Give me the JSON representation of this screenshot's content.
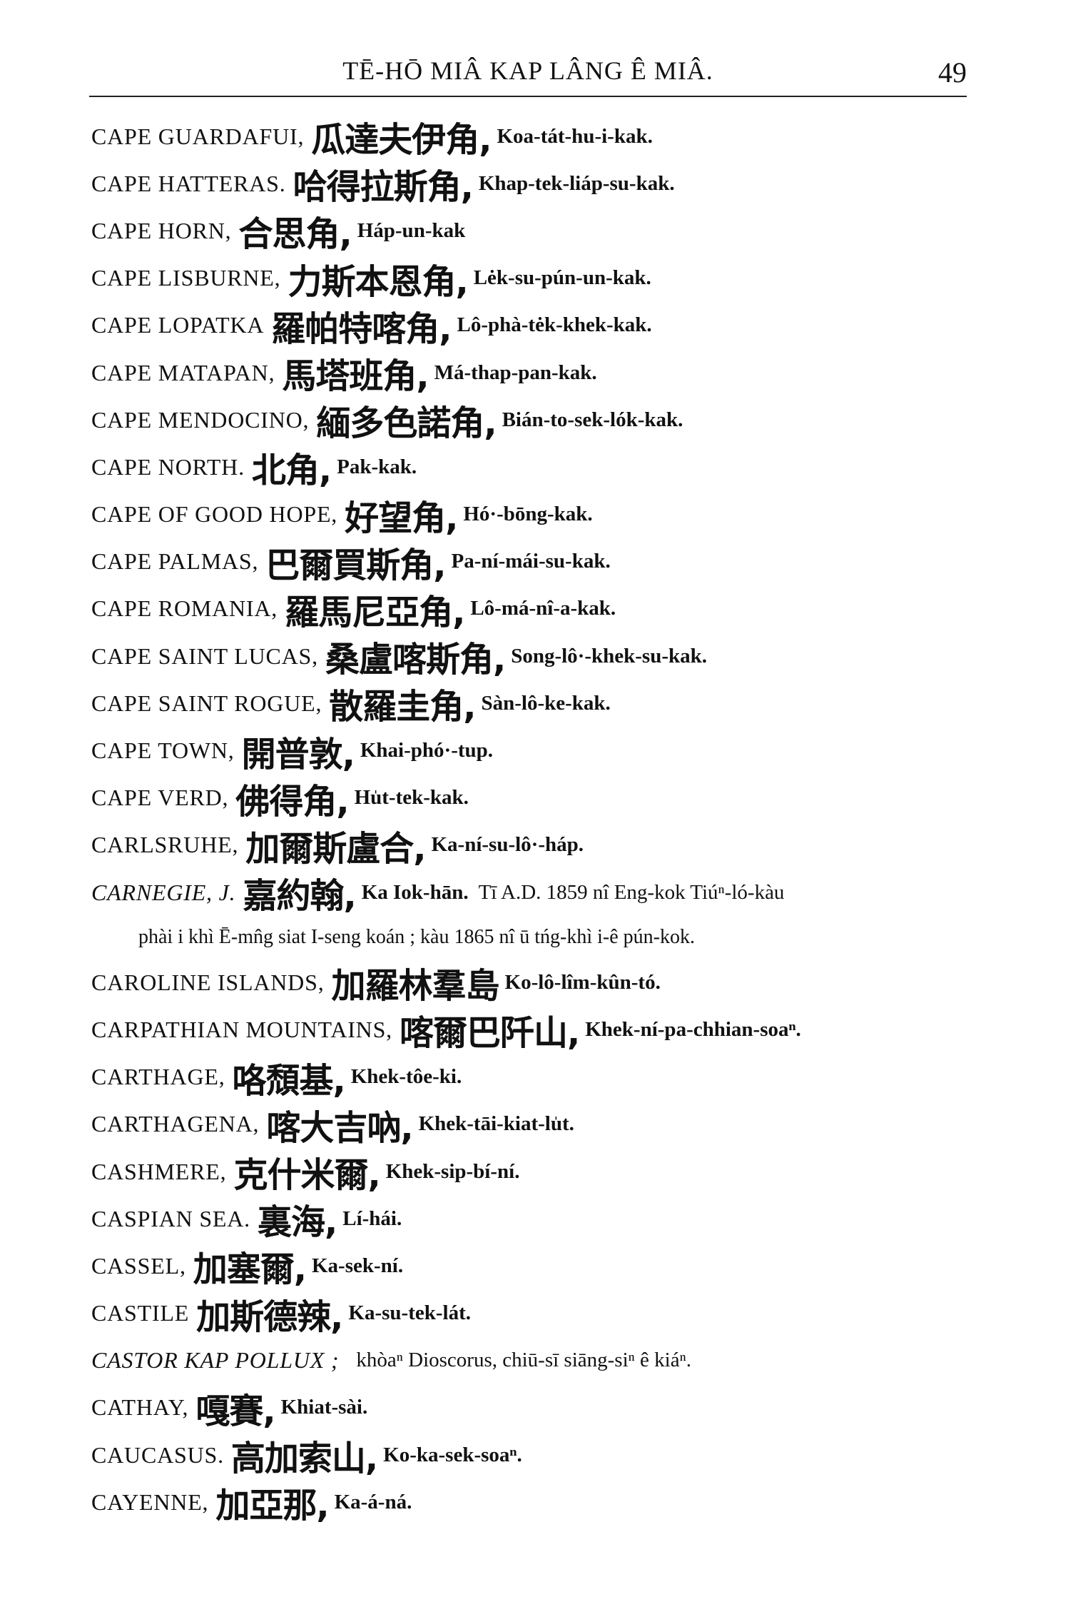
{
  "header": {
    "title": "TĒ-HŌ MIÂ KAP LÂNG Ê MIÂ.",
    "page_number": "49"
  },
  "entries": [
    {
      "en": "CAPE GUARDAFUI,",
      "zh": "瓜達夫伊角,",
      "rom": "Koa-tát-hu-i-kak."
    },
    {
      "en": "CAPE HATTERAS.",
      "zh": "哈得拉斯角,",
      "rom": "Khap-tek-liáp-su-kak."
    },
    {
      "en": "CAPE HORN,",
      "zh": "合思角,",
      "rom": "Háp-un-kak"
    },
    {
      "en": "CAPE LISBURNE,",
      "zh": "力斯本恩角,",
      "rom": "Lėk-su-pún-un-kak."
    },
    {
      "en": "CAPE LOPATKA",
      "zh": "羅帕特喀角,",
      "rom": "Lô-phà-tėk-khek-kak."
    },
    {
      "en": "CAPE MATAPAN,",
      "zh": "馬塔班角,",
      "rom": "Má-thap-pan-kak."
    },
    {
      "en": "CAPE MENDOCINO,",
      "zh": "緬多色諾角,",
      "rom": "Bián-to-sek-lók-kak."
    },
    {
      "en": "CAPE NORTH.",
      "zh": "北角,",
      "rom": "Pak-kak."
    },
    {
      "en": "CAPE OF GOOD HOPE,",
      "zh": "好望角,",
      "rom": "Hó·-bōng-kak."
    },
    {
      "en": "CAPE PALMAS,",
      "zh": "巴爾買斯角,",
      "rom": "Pa-ní-mái-su-kak."
    },
    {
      "en": "CAPE ROMANIA,",
      "zh": "羅馬尼亞角,",
      "rom": "Lô-má-nî-a-kak."
    },
    {
      "en": "CAPE SAINT LUCAS,",
      "zh": "桑盧喀斯角,",
      "rom": "Song-lô·-khek-su-kak."
    },
    {
      "en": "CAPE SAINT ROGUE,",
      "zh": "散羅圭角,",
      "rom": "Sàn-lô-ke-kak."
    },
    {
      "en": "CAPE TOWN,",
      "zh": "開普敦,",
      "rom": "Khai-phó·-tup."
    },
    {
      "en": "CAPE VERD,",
      "zh": "佛得角,",
      "rom": "Hu̍t-tek-kak."
    },
    {
      "en": "CARLSRUHE,",
      "zh": "加爾斯盧合,",
      "rom": "Ka-ní-su-lô·-háp."
    },
    {
      "en": "CARNEGIE, J.",
      "zh": "嘉約翰,",
      "rom": "Ka Iok-hān.",
      "note": "Tī A.D. 1859 nî Eng-kok Tiúⁿ-ló-kàu",
      "italic": true
    },
    {
      "cont": "phài i khì Ē-mn̂g siat I-seng koán ; kàu 1865 nî ū tńg-khì i-ê pún-kok."
    },
    {
      "en": "CAROLINE ISLANDS,",
      "zh": "加羅林羣島",
      "rom": "Ko-lô-lîm-kûn-tó."
    },
    {
      "en": "CARPATHIAN MOUNTAINS,",
      "zh": "喀爾巴阡山,",
      "rom": "Khek-ní-pa-chhian-soaⁿ."
    },
    {
      "en": "CARTHAGE,",
      "zh": "咯頹基,",
      "rom": "Khek-tôe-ki."
    },
    {
      "en": "CARTHAGENA,",
      "zh": "喀大吉吶,",
      "rom": "Khek-tāi-kiat-lu̍t."
    },
    {
      "en": "CASHMERE,",
      "zh": "克什米爾,",
      "rom": "Khek-sip-bí-ní."
    },
    {
      "en": "CASPIAN SEA.",
      "zh": "裏海,",
      "rom": "Lí-hái."
    },
    {
      "en": "CASSEL,",
      "zh": "加塞爾,",
      "rom": "Ka-sek-ní."
    },
    {
      "en": "CASTILE",
      "zh": "加斯德辣,",
      "rom": "Ka-su-tek-lát."
    },
    {
      "en": "CASTOR KAP POLLUX ;",
      "note": "khòaⁿ Dioscorus, chiū-sī siāng-siⁿ ê kiáⁿ.",
      "italic": true
    },
    {
      "en": "CATHAY,",
      "zh": "嘎賽,",
      "rom": "Khiat-sài."
    },
    {
      "en": "CAUCASUS.",
      "zh": "高加索山,",
      "rom": "Ko-ka-sek-soaⁿ."
    },
    {
      "en": "CAYENNE,",
      "zh": "加亞那,",
      "rom": "Ka-á-ná."
    }
  ]
}
